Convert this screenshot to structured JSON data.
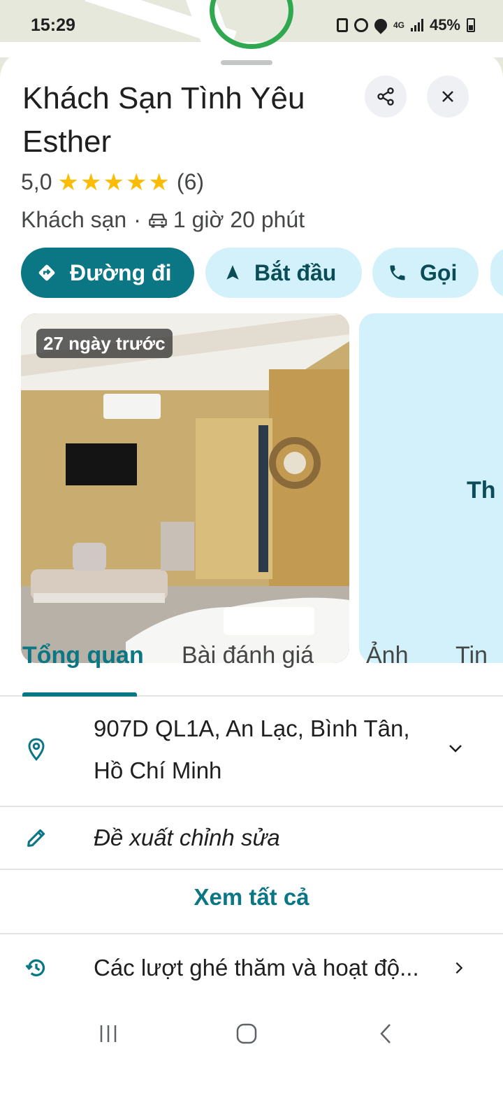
{
  "status_bar": {
    "time": "15:29",
    "network": "4G",
    "battery": "45%"
  },
  "place": {
    "name": "Khách Sạn Tình Yêu Esther",
    "rating": "5,0",
    "stars": 5,
    "review_count": "(6)",
    "category": "Khách sạn",
    "separator": "·",
    "travel_time": "1 giờ 20 phút"
  },
  "actions": {
    "directions": "Đường đi",
    "start": "Bắt đầu",
    "call": "Gọi"
  },
  "photos": {
    "main_tag": "27 ngày trước",
    "side_label": "Th"
  },
  "tabs": [
    "Tổng quan",
    "Bài đánh giá",
    "Ảnh",
    "Tin"
  ],
  "details": {
    "address": "907D QL1A, An Lạc, Bình Tân, Hồ Chí Minh",
    "suggest_edit": "Đề xuất chỉnh sửa",
    "see_all": "Xem tất cả",
    "visits": "Các lượt ghé thăm và hoạt độ..."
  },
  "colors": {
    "accent": "#0b7785",
    "chip_secondary_bg": "#d2f1fb",
    "star": "#fbbc04"
  },
  "icons": {
    "share": "share-icon",
    "close": "close-icon",
    "directions": "directions-diamond-icon",
    "start": "navigation-arrow-icon",
    "call": "phone-icon",
    "car": "car-icon",
    "location": "location-pin-icon",
    "edit": "pencil-icon",
    "history": "history-icon"
  }
}
